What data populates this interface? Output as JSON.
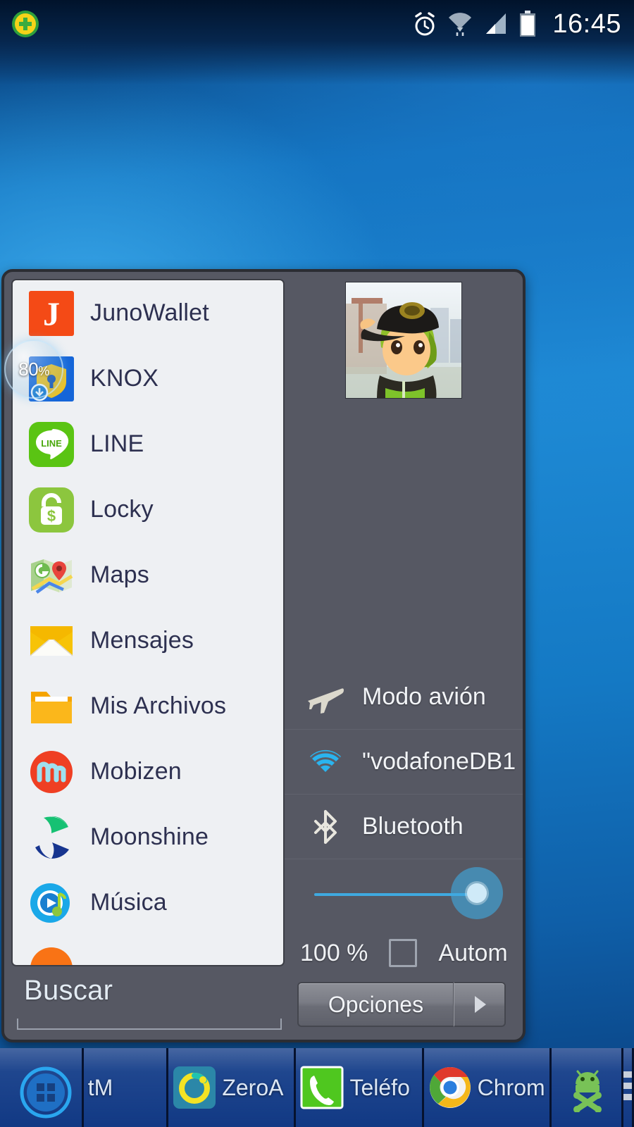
{
  "statusbar": {
    "time": "16:45",
    "icons": [
      {
        "name": "app-notification-icon",
        "label": "notification"
      },
      {
        "name": "alarm-icon",
        "label": "alarm"
      },
      {
        "name": "wifi-icon",
        "label": "wifi"
      },
      {
        "name": "signal-icon",
        "label": "signal"
      },
      {
        "name": "battery-icon",
        "label": "battery"
      }
    ]
  },
  "bubble": {
    "value": "80",
    "unit": "%"
  },
  "app_list": [
    {
      "label": "JunoWallet",
      "icon": "junowallet-icon"
    },
    {
      "label": "KNOX",
      "icon": "knox-icon"
    },
    {
      "label": "LINE",
      "icon": "line-icon"
    },
    {
      "label": "Locky",
      "icon": "locky-icon"
    },
    {
      "label": "Maps",
      "icon": "maps-icon"
    },
    {
      "label": "Mensajes",
      "icon": "mensajes-icon"
    },
    {
      "label": "Mis Archivos",
      "icon": "mis-archivos-icon"
    },
    {
      "label": "Mobizen",
      "icon": "mobizen-icon"
    },
    {
      "label": "Moonshine",
      "icon": "moonshine-icon"
    },
    {
      "label": "Música",
      "icon": "musica-icon"
    },
    {
      "label": "",
      "icon": "partial-orange-icon"
    }
  ],
  "search": {
    "label": "Buscar",
    "value": ""
  },
  "quick_settings": {
    "avatar_name": "anime-avatar",
    "toggles": [
      {
        "label": "Modo avión",
        "icon": "airplane-icon",
        "state": "off"
      },
      {
        "label": "\"vodafoneDB1",
        "icon": "wifi-icon",
        "state": "on"
      },
      {
        "label": "Bluetooth",
        "icon": "bluetooth-icon",
        "state": "off"
      }
    ],
    "brightness": {
      "percent_label": "100 %",
      "value": 100,
      "auto_label": "Autom",
      "auto_checked": false
    },
    "buttons": {
      "options_label": "Opciones",
      "arrow_label": "▶"
    }
  },
  "taskbar": [
    {
      "label": "",
      "icon": "home-grid-icon",
      "name": "task-home"
    },
    {
      "label": "tM",
      "icon": "tm-icon",
      "name": "task-tm"
    },
    {
      "label": "ZeroA",
      "icon": "zeroa-icon",
      "name": "task-zeroa"
    },
    {
      "label": "Teléfo",
      "icon": "phone-icon",
      "name": "task-telefo"
    },
    {
      "label": "Chrom",
      "icon": "chrome-icon",
      "name": "task-chrom"
    },
    {
      "label": "",
      "icon": "android-skull-icon",
      "name": "task-android"
    },
    {
      "label": "",
      "icon": "menu-list-icon",
      "name": "task-menu"
    }
  ],
  "colors": {
    "accent_blue": "#3fa9e0",
    "window_bg": "#565863",
    "list_bg": "#eef0f3",
    "label_text": "#2d3050"
  }
}
